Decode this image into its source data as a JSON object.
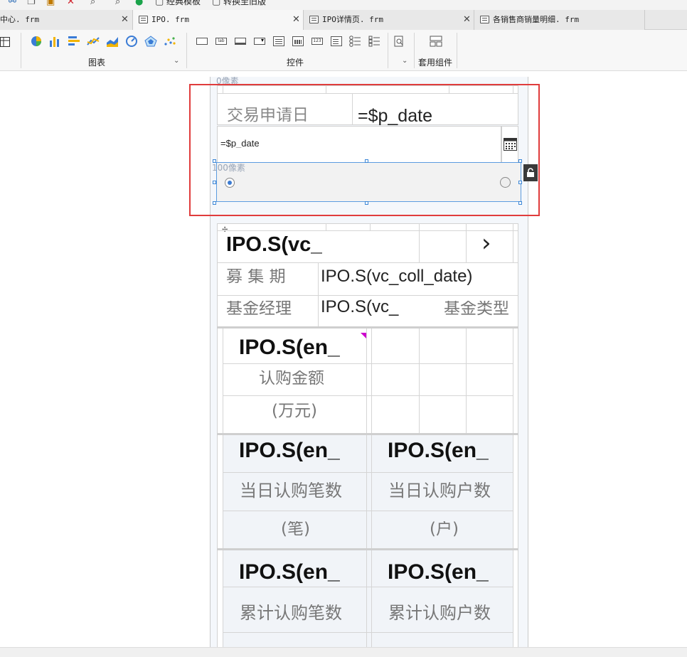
{
  "toolbar": {
    "classic_template_label": "经典模板",
    "convert_old_label": "转换至旧版"
  },
  "tabs": [
    {
      "label": "中心. frm",
      "active": false
    },
    {
      "label": "IPO. frm",
      "active": true
    },
    {
      "label": "IPO详情页. frm",
      "active": false
    },
    {
      "label": "各销售商销量明细. frm",
      "active": false
    }
  ],
  "ribbon": {
    "chart_group_label": "图表",
    "control_group_label": "控件",
    "suite_group_label": "套用组件",
    "chart_icons": [
      "pie-chart-icon",
      "bar-chart-icon",
      "horizontal-bar-icon",
      "line-chart-icon",
      "area-chart-icon",
      "gauge-icon",
      "radar-icon",
      "scatter-icon"
    ],
    "control_icons": [
      "button-control-icon",
      "label-control-icon",
      "text-field-icon",
      "dropdown-icon",
      "list-icon",
      "date-picker-icon",
      "number-field-icon",
      "textarea-icon",
      "radio-group-icon",
      "checkbox-group-icon",
      "tree-icon",
      "search-icon",
      "layout-icon"
    ]
  },
  "form": {
    "top_block_height_label": "0像素",
    "trade_date_label": "交易申请日",
    "trade_date_expr": "=$p_date",
    "date_field_value": "=$p_date",
    "radio_block_height_label": "100像素"
  },
  "report": {
    "row1_title": "IPO.S(vc_",
    "chevron": "›",
    "coll_period_label": "募 集 期",
    "coll_period_value": "IPO.S(vc_coll_date)",
    "fund_manager_label": "基金经理",
    "fund_manager_value": "IPO.S(vc_",
    "fund_type_label": "基金类型",
    "sub_amount_value": "IPO.S(en_",
    "sub_amount_label_1": "认购金额",
    "sub_amount_label_2": "(万元)",
    "daily_count_value": "IPO.S(en_",
    "daily_count_label_1": "当日认购笔数",
    "daily_count_label_2": "(笔)",
    "daily_users_value": "IPO.S(en_",
    "daily_users_label_1": "当日认购户数",
    "daily_users_label_2": "(户)",
    "total_count_value": "IPO.S(en_",
    "total_count_label_1": "累计认购笔数",
    "total_users_value": "IPO.S(en_",
    "total_users_label_1": "累计认购户数"
  },
  "colors": {
    "selection_box": "#e03c3c",
    "selection_handle": "#3b86d6",
    "corner_marker": "#cc00cc"
  }
}
